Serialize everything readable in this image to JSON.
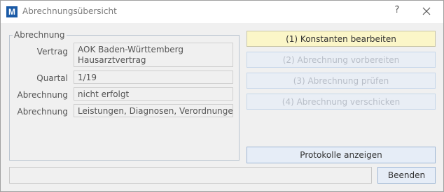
{
  "window": {
    "title": "Abrechnungsübersicht",
    "app_icon_letter": "M",
    "help_label": "?"
  },
  "group": {
    "legend": "Abrechnung",
    "rows": [
      {
        "label": "Vertrag",
        "value": "AOK Baden-Württemberg\nHausarztvertrag"
      },
      {
        "label": "Quartal",
        "value": "1/19"
      },
      {
        "label": "Abrechnung",
        "value": "nicht erfolgt"
      },
      {
        "label": "Abrechnung",
        "value": "Leistungen, Diagnosen, Verordnungen"
      }
    ]
  },
  "actions": {
    "step1": "(1) Konstanten bearbeiten",
    "step2": "(2) Abrechnung vorbereiten",
    "step3": "(3) Abrechnung prüfen",
    "step4": "(4) Abrechnung verschicken",
    "protocols": "Protokolle anzeigen",
    "close": "Beenden"
  },
  "status": {
    "text": ""
  },
  "colors": {
    "primary_button_bg": "#fbf6c8",
    "disabled_text": "#b8bec8",
    "app_icon_bg": "#1a5aa6"
  }
}
